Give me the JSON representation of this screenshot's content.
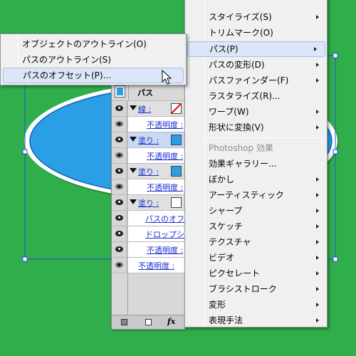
{
  "colors": {
    "background": "#2fae4b",
    "ellipse_fill": "#2a9fe6",
    "ellipse_border": "#ffffff",
    "selection": "#2c4fe0",
    "link": "#1a2fcf",
    "menu_highlight": "#dbe7f7"
  },
  "appearance_panel": {
    "header": "パス",
    "rows": [
      {
        "kind": "stroke",
        "label": "線 :"
      },
      {
        "kind": "opacity",
        "label": "不透明度 :"
      },
      {
        "kind": "fill",
        "label": "塗り :",
        "swatch": "#2a9fe6"
      },
      {
        "kind": "opacity",
        "label": "不透明度 :"
      },
      {
        "kind": "fill",
        "label": "塗り :",
        "swatch": "#2a9fe6"
      },
      {
        "kind": "opacity",
        "label": "不透明度 :"
      },
      {
        "kind": "fill",
        "label": "塗り :",
        "swatch": "#ffffff"
      },
      {
        "kind": "effect",
        "label": "パスのオフセッ"
      },
      {
        "kind": "effect",
        "label": "ドロップシャ"
      },
      {
        "kind": "opacity",
        "label": "不透明度 :"
      },
      {
        "kind": "opacity",
        "label": "不透明度 :"
      }
    ],
    "footer_icons": [
      "square-icon",
      "square-outline-icon",
      "fx-icon"
    ],
    "fx_label": "fx"
  },
  "main_menu": {
    "items": [
      {
        "label": "スタイライズ(S)",
        "submenu": true
      },
      {
        "label": "トリムマーク(O)",
        "submenu": false
      },
      {
        "label": "パス(P)",
        "submenu": true,
        "highlighted": true
      },
      {
        "label": "パスの変形(D)",
        "submenu": true
      },
      {
        "label": "パスファインダー(F)",
        "submenu": true
      },
      {
        "label": "ラスタライズ(R)...",
        "submenu": false
      },
      {
        "label": "ワープ(W)",
        "submenu": true
      },
      {
        "label": "形状に変換(V)",
        "submenu": true
      },
      {
        "label": "Photoshop 効果",
        "submenu": false,
        "disabled": true
      },
      {
        "label": "効果ギャラリー...",
        "submenu": false
      },
      {
        "label": "ぼかし",
        "submenu": true
      },
      {
        "label": "アーティスティック",
        "submenu": true
      },
      {
        "label": "シャープ",
        "submenu": true
      },
      {
        "label": "スケッチ",
        "submenu": true
      },
      {
        "label": "テクスチャ",
        "submenu": true
      },
      {
        "label": "ビデオ",
        "submenu": true
      },
      {
        "label": "ピクセレート",
        "submenu": true
      },
      {
        "label": "ブラシストローク",
        "submenu": true
      },
      {
        "label": "変形",
        "submenu": true
      },
      {
        "label": "表現手法",
        "submenu": true
      }
    ]
  },
  "submenu": {
    "items": [
      {
        "label": "オブジェクトのアウトライン(O)"
      },
      {
        "label": "パスのアウトライン(S)"
      },
      {
        "label": "パスのオフセット(P)...",
        "highlighted": true
      }
    ]
  }
}
